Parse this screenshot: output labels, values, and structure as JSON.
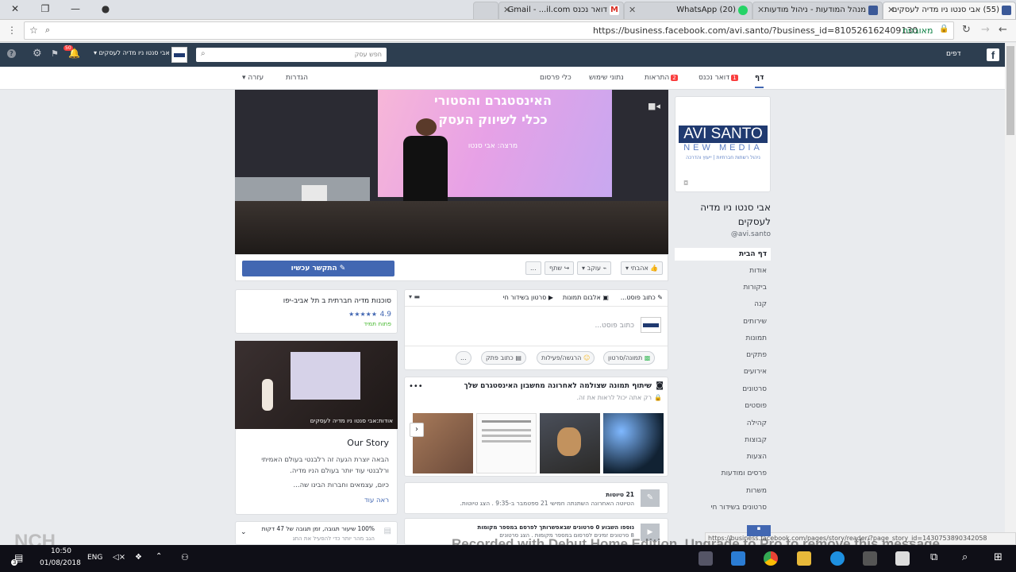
{
  "tabs": [
    {
      "title": "(55) אבי סנטו ניו מדיה לעסקים",
      "active": true
    },
    {
      "title": "מנהל המודעות - ניהול מודעות"
    },
    {
      "title": "(20) WhatsApp"
    },
    {
      "title": "דואר נכנס Gmail - ...il.com"
    },
    {
      "title": ""
    }
  ],
  "address": {
    "secure_label": "מאובטח",
    "url": "https://business.facebook.com/avi.santo/?business_id=810526162409130"
  },
  "fbbar": {
    "pages_label": "דפים",
    "search_placeholder": "חפש עסק",
    "page_selector": "אבי סנטו ניו מדיה לעסקים",
    "notif_count": "50"
  },
  "pagenav": {
    "page": "דף",
    "inbox": "דואר נכנס",
    "inbox_count": "1",
    "notifications": "התראות",
    "notif_count": "2",
    "insights": "נתוני שימוש",
    "publishing_tools": "כלי פרסום",
    "settings": "הגדרות",
    "help": "עזרה"
  },
  "cover": {
    "slide_line1": "האינסטגרם והסטורי",
    "slide_line2": "ככלי לשיווק העסק",
    "slide_line3": "מרצה: אבי סנטו"
  },
  "actions": {
    "like": "אהבתי",
    "follow": "עוקב",
    "share": "שתף",
    "more": "...",
    "contact": "התקשר עכשיו"
  },
  "profile": {
    "logo_line1": "AVI SANTO",
    "logo_line2": "NEW MEDIA",
    "logo_tagline": "ניהול רשתות חברתיות | ייעוץ והדרכה",
    "name": "אבי סנטו ניו מדיה לעסקים",
    "username": "@avi.santo"
  },
  "sidemenu": [
    "דף הבית",
    "אודות",
    "ביקורות",
    "קנה",
    "שירותים",
    "תמונות",
    "פתקים",
    "אירועים",
    "סרטונים",
    "פוסטים",
    "קהילה",
    "קבוצות",
    "הצעות",
    "פרסים ומודעות",
    "משרות",
    "סרטונים בשידור חי"
  ],
  "composer": {
    "write_post": "כתוב פוסט...",
    "photo_album": "אלבום תמונות",
    "live_video": "סרטון בשידור חי",
    "placeholder": "כתוב פוסט...",
    "photo_video": "תמונה/סרטון",
    "feeling": "הרגשה/פעילות",
    "note": "כתוב פתק",
    "more": "..."
  },
  "instagram": {
    "title": "שיתוף תמונה שצולמה לאחרונה מחשבון האינסטגרם שלך",
    "subtitle": "רק אתה יכול לראות את זה."
  },
  "drafts": {
    "count": "21 טיוטות",
    "detail": "הטיוטה האחרונה השתנתה חמישי 21 ספטמבר ב-9:35 . הצג טיוטות."
  },
  "videos_row": {
    "title": "נוספו השבוע 0 סרטונים שבאפשרותך לפרסם במספר מקומות",
    "detail": "8 סרטונים זמינים לפרסום במספר מקומות . הצג סרטונים"
  },
  "leftcol": {
    "category": "סוכנות מדיה חברתית ב תל אביב-יפו",
    "rating": "4.9",
    "stars": "★★★★★",
    "open": "פתוח תמיד",
    "about_caption": "אודות:אבי סנטו ניו מדיה לעסקים",
    "story_title": "Our Story",
    "story_line1": "הבאה יוצרת הגעה זה רלבנטי בעולם האמיתי",
    "story_line2": "ורלבנטי עוד יותר בעולם הניו מדיה.",
    "story_line3": "כיום, עצמאים וחברות הבינו שה...",
    "see_more": "ראה עוד",
    "response_title": "100% שיעור תגובה, זמן תגובה של 47 דקות",
    "response_detail": "הגב מהר יותר כדי להפעיל את התג"
  },
  "statusbar_url": "https://business.facebook.com/pages/story/reader/?page_story_id=1430753890342058",
  "watermark": "Recorded with Debut Home Edition. Upgrade to Pro to remove this message",
  "taskbar": {
    "time": "10:50",
    "date": "01/08/2018",
    "lang": "ENG"
  }
}
